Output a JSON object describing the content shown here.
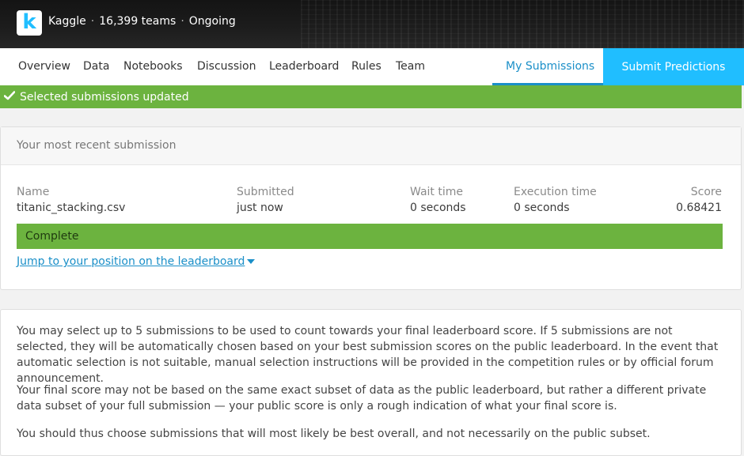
{
  "header": {
    "logo_letter": "k",
    "brand": "Kaggle",
    "teams": "16,399 teams",
    "status": "Ongoing",
    "separator": "·"
  },
  "nav": {
    "tabs": [
      "Overview",
      "Data",
      "Notebooks",
      "Discussion",
      "Leaderboard",
      "Rules",
      "Team"
    ],
    "my_submissions": "My Submissions",
    "submit_button": "Submit Predictions"
  },
  "alert": {
    "message": "Selected submissions updated",
    "icon": "check-icon"
  },
  "recent": {
    "title": "Your most recent submission",
    "columns": {
      "name": {
        "label": "Name",
        "value": "titanic_stacking.csv"
      },
      "submitted": {
        "label": "Submitted",
        "value": "just now"
      },
      "wait": {
        "label": "Wait time",
        "value": "0 seconds"
      },
      "execution": {
        "label": "Execution time",
        "value": "0 seconds"
      },
      "score": {
        "label": "Score",
        "value": "0.68421"
      }
    },
    "status": "Complete",
    "jump_link": "Jump to your position on the leaderboard"
  },
  "info": {
    "paragraphs": [
      "You may select up to 5 submissions to be used to count towards your final leaderboard score. If 5 submissions are not selected, they will be automatically chosen based on your best submission scores on the public leaderboard. In the event that automatic selection is not suitable, manual selection instructions will be provided in the competition rules or by official forum announcement.",
      "Your final score may not be based on the same exact subset of data as the public leaderboard, but rather a different private data subset of your full submission — your public score is only a rough indication of what your final score is.",
      "You should thus choose submissions that will most likely be best overall, and not necessarily on the public subset."
    ]
  },
  "colors": {
    "accent": "#20beff",
    "link": "#1a8fc8",
    "success": "#6cb33f"
  }
}
